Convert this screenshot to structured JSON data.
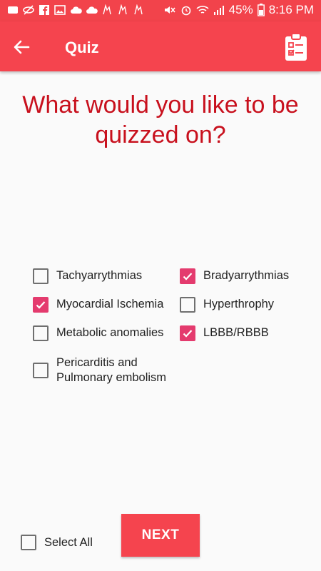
{
  "status_bar": {
    "battery": "45%",
    "time": "8:16 PM"
  },
  "app_bar": {
    "title": "Quiz",
    "back_icon": "arrow-left-icon",
    "action_icon": "clipboard-checklist-icon"
  },
  "question": "What would you like to be quizzed on?",
  "options": [
    {
      "label": "Tachyarrythmias",
      "checked": false
    },
    {
      "label": "Bradyarrythmias",
      "checked": true
    },
    {
      "label": "Myocardial Ischemia",
      "checked": true
    },
    {
      "label": "Hyperthrophy",
      "checked": false
    },
    {
      "label": "Metabolic anomalies",
      "checked": false
    },
    {
      "label": "LBBB/RBBB",
      "checked": true
    },
    {
      "label": "Pericarditis and Pulmonary embolism",
      "checked": false
    }
  ],
  "select_all": {
    "label": "Select All",
    "checked": false
  },
  "next_label": "NEXT",
  "colors": {
    "primary": "#f5444e",
    "question_text": "#c8101d",
    "checkbox_checked": "#e43b6e"
  }
}
